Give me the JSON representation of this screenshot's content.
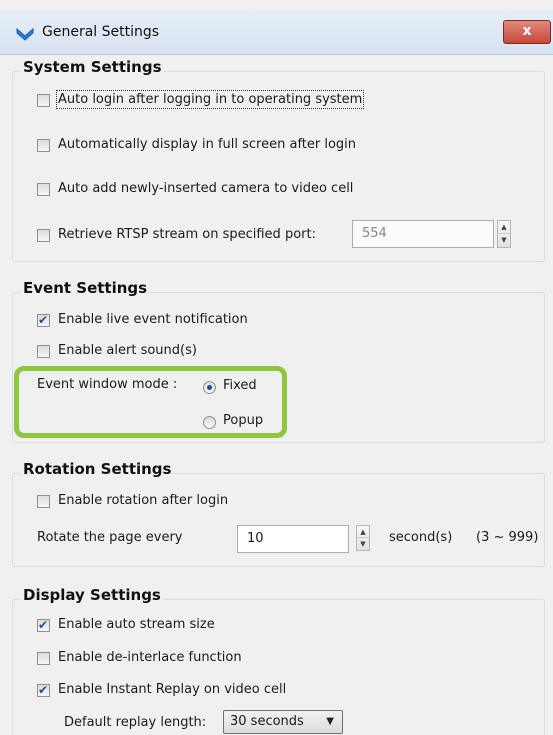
{
  "window": {
    "title": "General Settings",
    "close_glyph": "x"
  },
  "system": {
    "heading": "System Settings",
    "auto_login": "Auto login after logging in to operating system",
    "auto_fullscreen": "Automatically display in full screen after login",
    "auto_add_camera": "Auto add newly-inserted camera to video cell",
    "retrieve_rtsp": "Retrieve RTSP stream on specified port:",
    "rtsp_port": "554"
  },
  "event": {
    "heading": "Event Settings",
    "live_notification": "Enable live event notification",
    "alert_sound": "Enable alert sound(s)",
    "window_mode_label": "Event window mode :",
    "mode_fixed": "Fixed",
    "mode_popup": "Popup"
  },
  "rotation": {
    "heading": "Rotation Settings",
    "enable_rotation": "Enable rotation after login",
    "rotate_every_label": "Rotate the page every",
    "rotate_value": "10",
    "unit": "second(s)",
    "range": "(3 ~ 999)"
  },
  "display": {
    "heading": "Display Settings",
    "auto_stream_size": "Enable auto stream size",
    "deinterlace": "Enable de-interlace function",
    "instant_replay": "Enable Instant Replay on video cell",
    "replay_length_label": "Default replay length:",
    "replay_length_value": "30 seconds"
  },
  "colors": {
    "highlight": "#8dc63f",
    "accent": "#1f4c9b",
    "close": "#c7473a"
  },
  "icons": {
    "app": "chevron-app-icon",
    "dropdown": "chevron-down-icon",
    "spin_up": "spin-up-icon",
    "spin_down": "spin-down-icon"
  }
}
